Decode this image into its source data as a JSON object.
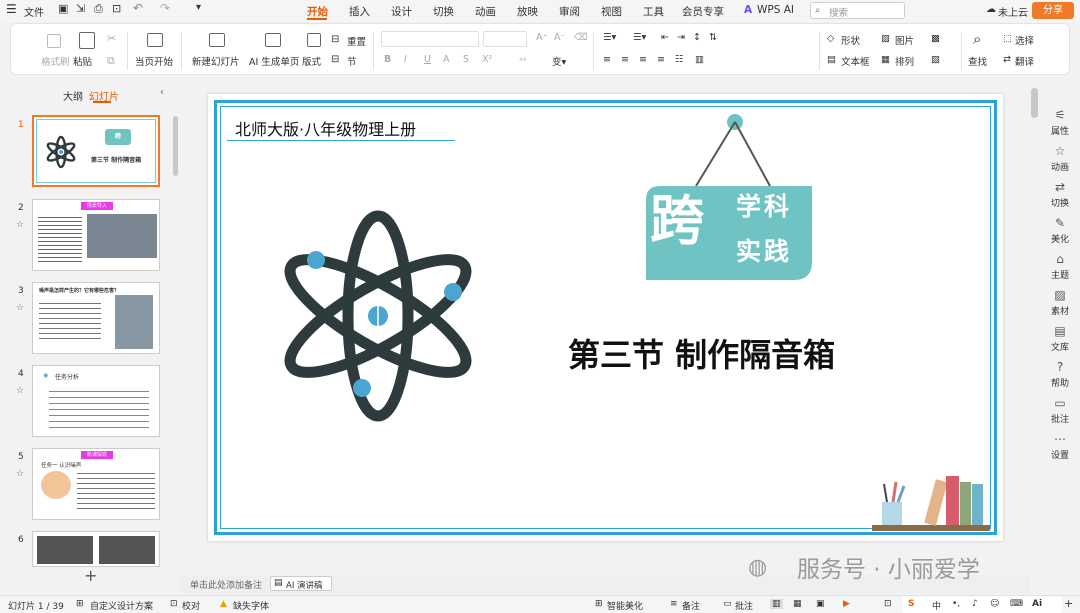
{
  "menu": {
    "file": "文件",
    "tabs": [
      "开始",
      "插入",
      "设计",
      "切换",
      "动画",
      "放映",
      "审阅",
      "视图",
      "工具",
      "会员专享",
      "WPS AI"
    ],
    "search_placeholder": "搜索",
    "cloud": "未上云",
    "share": "分享"
  },
  "ribbon": {
    "format_painter": "格式刷",
    "paste": "粘贴",
    "from_current": "当页开始",
    "new_slide": "新建幻灯片",
    "ai_single": "AI 生成单页",
    "layout": "版式",
    "reset": "重置",
    "section": "节",
    "shape": "形状",
    "picture": "图片",
    "textbox": "文本框",
    "arrange": "排列",
    "find": "查找",
    "select": "选择",
    "translate": "翻译"
  },
  "left_panel": {
    "tab_outline": "大纲",
    "tab_slides": "幻灯片",
    "add": "+"
  },
  "thumbnails": [
    {
      "num": "1",
      "title": "第三节 制作隔音箱"
    },
    {
      "num": "2",
      "badge": "情景导入"
    },
    {
      "num": "3",
      "question": "噪声是怎样产生的？它有哪些危害？"
    },
    {
      "num": "4",
      "heading": "任务分析"
    },
    {
      "num": "5",
      "badge": "新课探究",
      "heading": "任务一 认识噪声"
    },
    {
      "num": "6"
    }
  ],
  "slide": {
    "header": "北师大版·八年级物理上册",
    "title": "第三节  制作隔音箱",
    "sign_big": "跨",
    "sign_line1": "学科",
    "sign_line2": "实践"
  },
  "notes": {
    "placeholder": "单击此处添加备注",
    "ai_notes": "AI 演讲稿"
  },
  "status": {
    "slide_count": "幻灯片 1 / 39",
    "design": "自定义设计方案",
    "proof": "校对",
    "missing_font": "缺失字体",
    "beautify": "智能美化",
    "notes": "备注",
    "comments": "批注"
  },
  "right_panel": [
    "属性",
    "动画",
    "切换",
    "美化",
    "主题",
    "素材",
    "文库",
    "帮助",
    "批注",
    "设置"
  ],
  "watermark": "服务号 · 小丽爱学",
  "ime": {
    "zh": "中",
    "ai": "Ai"
  },
  "colors": {
    "accent": "#e65c00",
    "teal": "#6fc3c3",
    "frame": "#2aa3d6",
    "atom": "#2e3b3d",
    "electron": "#4aa6cf"
  }
}
